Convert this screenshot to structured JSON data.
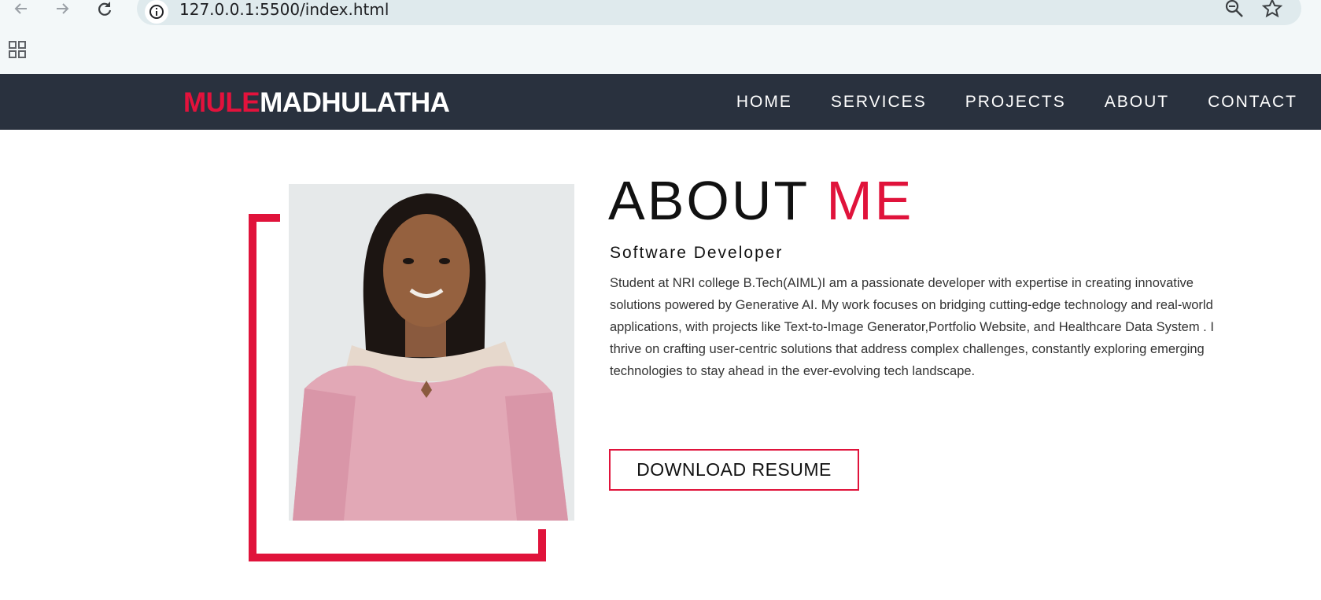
{
  "browser": {
    "url": "127.0.0.1:5500/index.html",
    "icons": [
      "back-arrow-icon",
      "forward-arrow-icon",
      "reload-icon",
      "site-info-icon",
      "zoom-icon",
      "bookmark-star-icon",
      "apps-grid-icon"
    ]
  },
  "nav": {
    "logo_first": "MULE",
    "logo_second": "MADHULATHA",
    "items": [
      "HOME",
      "SERVICES",
      "PROJECTS",
      "ABOUT",
      "CONTACT"
    ]
  },
  "about": {
    "title_main": "ABOUT",
    "title_accent": "ME",
    "role": "Software Developer",
    "bio": "Student at NRI college B.Tech(AIML)I am a passionate developer with expertise in creating innovative solutions powered by Generative AI. My work focuses on bridging cutting-edge technology and real-world applications, with projects like Text-to-Image Generator,Portfolio Website, and Healthcare Data System . I thrive on crafting user-centric solutions that address complex challenges, constantly exploring emerging technologies to stay ahead in the ever-evolving tech landscape.",
    "button": "DOWNLOAD RESUME"
  },
  "colors": {
    "accent": "#e0133b",
    "nav_bg": "#29313e"
  }
}
